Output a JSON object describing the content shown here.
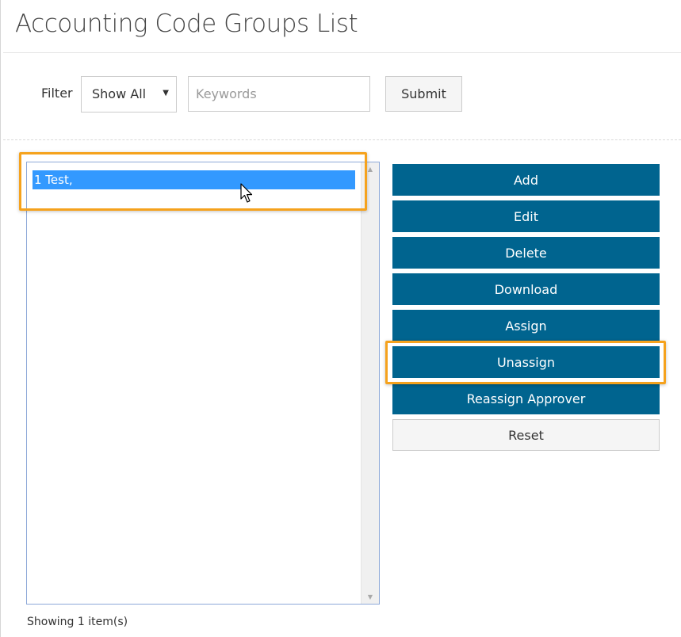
{
  "page": {
    "title": "Accounting Code Groups List"
  },
  "filter": {
    "label": "Filter",
    "selected": "Show All",
    "keywords_placeholder": "Keywords",
    "submit_label": "Submit"
  },
  "list": {
    "items": [
      {
        "label": "1 Test,"
      }
    ],
    "selected_index": 0,
    "footer": "Showing 1 item(s)"
  },
  "actions": {
    "add": "Add",
    "edit": "Edit",
    "delete": "Delete",
    "download": "Download",
    "assign": "Assign",
    "unassign": "Unassign",
    "reassign_approver": "Reassign Approver",
    "reset": "Reset"
  },
  "icons": {
    "caret": "caret-down-icon",
    "cursor": "mouse-pointer-icon",
    "scroll_up": "scroll-up-arrow-icon",
    "scroll_down": "scroll-down-arrow-icon"
  },
  "colors": {
    "action_button": "#00648f",
    "selected_item": "#3399ff",
    "highlight": "#f5a21d"
  }
}
